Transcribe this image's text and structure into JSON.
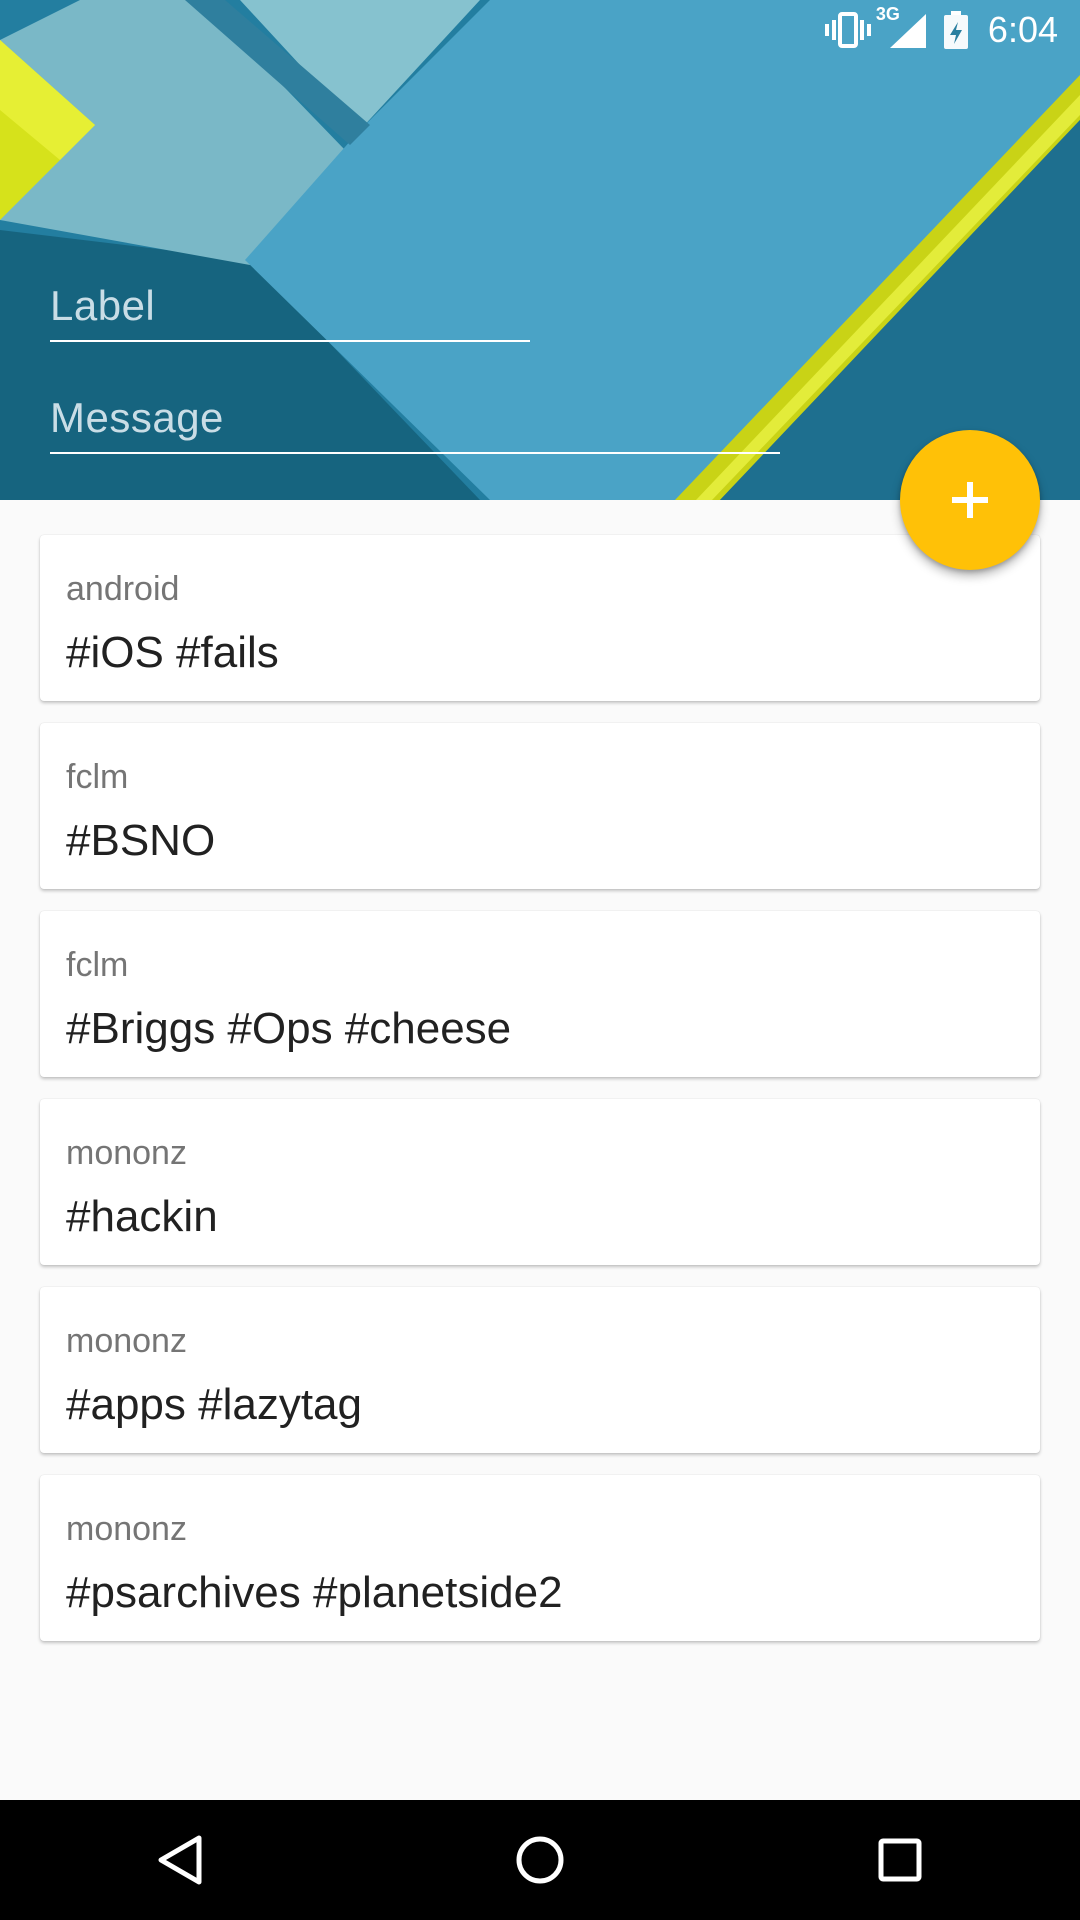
{
  "status_bar": {
    "network": "3G",
    "time": "6:04"
  },
  "form": {
    "label_placeholder": "Label",
    "message_placeholder": "Message"
  },
  "fab": {
    "icon": "plus-icon",
    "color": "#ffc107"
  },
  "cards": [
    {
      "user": "android",
      "message": "#iOS #fails"
    },
    {
      "user": "fclm",
      "message": "#BSNO"
    },
    {
      "user": "fclm",
      "message": "#Briggs #Ops #cheese"
    },
    {
      "user": "mononz",
      "message": "#hackin"
    },
    {
      "user": "mononz",
      "message": "#apps #lazytag"
    },
    {
      "user": "mononz",
      "message": "#psarchives #planetside2"
    }
  ],
  "nav": {
    "back_icon": "back-triangle-icon",
    "home_icon": "home-circle-icon",
    "recents_icon": "recents-square-icon"
  }
}
